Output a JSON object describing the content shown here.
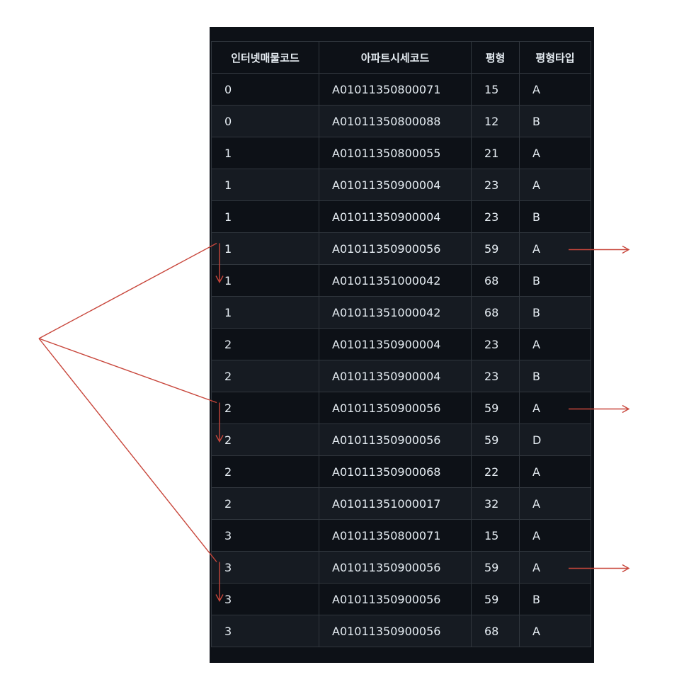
{
  "table": {
    "columns": [
      "인터넷매물코드",
      "아파트시세코드",
      "평형",
      "평형타입"
    ],
    "rows": [
      [
        "0",
        "A01011350800071",
        "15",
        "A"
      ],
      [
        "0",
        "A01011350800088",
        "12",
        "B"
      ],
      [
        "1",
        "A01011350800055",
        "21",
        "A"
      ],
      [
        "1",
        "A01011350900004",
        "23",
        "A"
      ],
      [
        "1",
        "A01011350900004",
        "23",
        "B"
      ],
      [
        "1",
        "A01011350900056",
        "59",
        "A"
      ],
      [
        "1",
        "A01011351000042",
        "68",
        "B"
      ],
      [
        "1",
        "A01011351000042",
        "68",
        "B"
      ],
      [
        "2",
        "A01011350900004",
        "23",
        "A"
      ],
      [
        "2",
        "A01011350900004",
        "23",
        "B"
      ],
      [
        "2",
        "A01011350900056",
        "59",
        "A"
      ],
      [
        "2",
        "A01011350900056",
        "59",
        "D"
      ],
      [
        "2",
        "A01011350900068",
        "22",
        "A"
      ],
      [
        "2",
        "A01011351000017",
        "32",
        "A"
      ],
      [
        "3",
        "A01011350800071",
        "15",
        "A"
      ],
      [
        "3",
        "A01011350900056",
        "59",
        "A"
      ],
      [
        "3",
        "A01011350900056",
        "59",
        "B"
      ],
      [
        "3",
        "A01011350900056",
        "68",
        "A"
      ]
    ]
  },
  "annotations": {
    "color": "#c8463b",
    "highlighted_rows": [
      5,
      10,
      15
    ]
  }
}
